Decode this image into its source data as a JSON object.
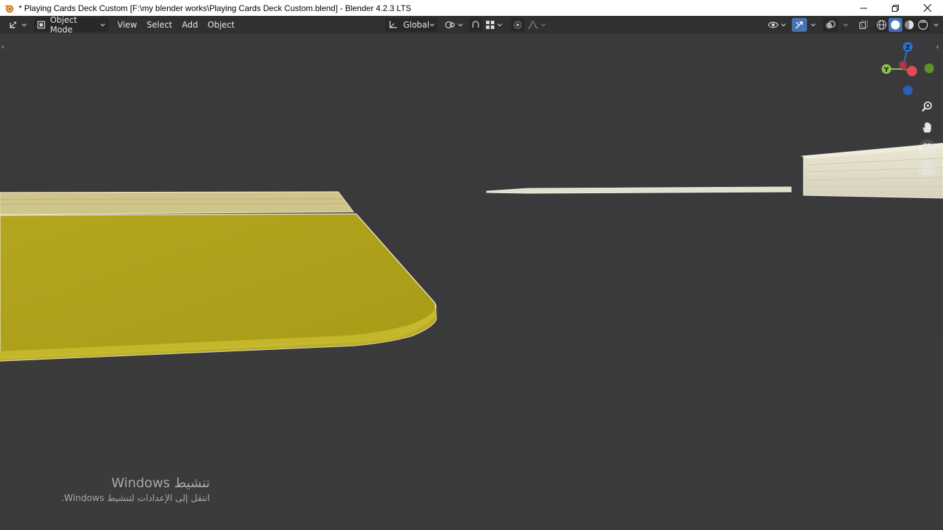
{
  "window": {
    "title": "* Playing Cards Deck Custom [F:\\my blender works\\Playing Cards Deck Custom.blend] - Blender 4.2.3 LTS",
    "controls": [
      "minimize",
      "restore",
      "close"
    ]
  },
  "header": {
    "editor_type_icon": "view3d-icon",
    "mode": "Object Mode",
    "menus": [
      "View",
      "Select",
      "Add",
      "Object"
    ],
    "orientation": "Global",
    "icons": {
      "pivot": "pivot-icon",
      "snap": "snap-magnet-icon",
      "snap_target": "snap-grid-icon",
      "proportional": "proportional-edit-icon",
      "falloff": "falloff-curve-icon",
      "visibility": "eye-icon",
      "gizmos": "gizmo-icon",
      "overlays": "overlay-icon",
      "xray": "xray-icon",
      "shading": [
        "wireframe-shading-icon",
        "solid-shading-icon",
        "material-shading-icon",
        "rendered-shading-icon"
      ]
    }
  },
  "gizmo": {
    "axes": [
      {
        "label": "Z",
        "color": "#2f6fd6"
      },
      {
        "label": "Y",
        "color": "#8bc34a"
      },
      {
        "label": "X",
        "color": "#e04a5a"
      }
    ]
  },
  "nav_buttons": [
    "zoom-icon",
    "pan-hand-icon",
    "camera-icon",
    "grid-view-icon"
  ],
  "colors": {
    "viewport_bg": "#3b3b3b",
    "header_bg": "#303030",
    "accent": "#4772b3",
    "deck_yellow": "#b3a51b",
    "card_white": "#e4e0cc"
  },
  "activation": {
    "line1": "تنشيط Windows",
    "line2": "انتقل إلى الإعدادات لتنشيط Windows."
  }
}
